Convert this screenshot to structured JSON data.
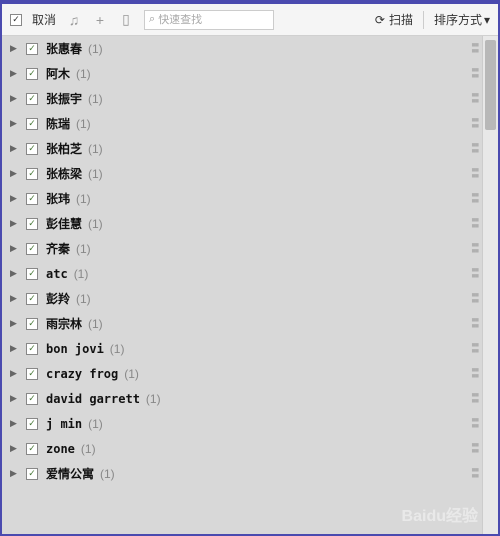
{
  "toolbar": {
    "cancel_label": "取消",
    "search_placeholder": "快速查找",
    "scan_label": "扫描",
    "sort_label": "排序方式"
  },
  "list": {
    "items": [
      {
        "name": "张惠春",
        "count": "(1)"
      },
      {
        "name": "阿木",
        "count": "(1)"
      },
      {
        "name": "张振宇",
        "count": "(1)"
      },
      {
        "name": "陈瑞",
        "count": "(1)"
      },
      {
        "name": "张柏芝",
        "count": "(1)"
      },
      {
        "name": "张栋梁",
        "count": "(1)"
      },
      {
        "name": "张玮",
        "count": "(1)"
      },
      {
        "name": "彭佳慧",
        "count": "(1)"
      },
      {
        "name": "齐秦",
        "count": "(1)"
      },
      {
        "name": "atc",
        "count": "(1)"
      },
      {
        "name": "彭羚",
        "count": "(1)"
      },
      {
        "name": "雨宗林",
        "count": "(1)"
      },
      {
        "name": "bon jovi",
        "count": "(1)"
      },
      {
        "name": "crazy frog",
        "count": "(1)"
      },
      {
        "name": "david garrett",
        "count": "(1)"
      },
      {
        "name": "j min",
        "count": "(1)"
      },
      {
        "name": "zone",
        "count": "(1)"
      },
      {
        "name": "爱情公寓",
        "count": "(1)"
      }
    ]
  },
  "watermark": "Baidu经验"
}
